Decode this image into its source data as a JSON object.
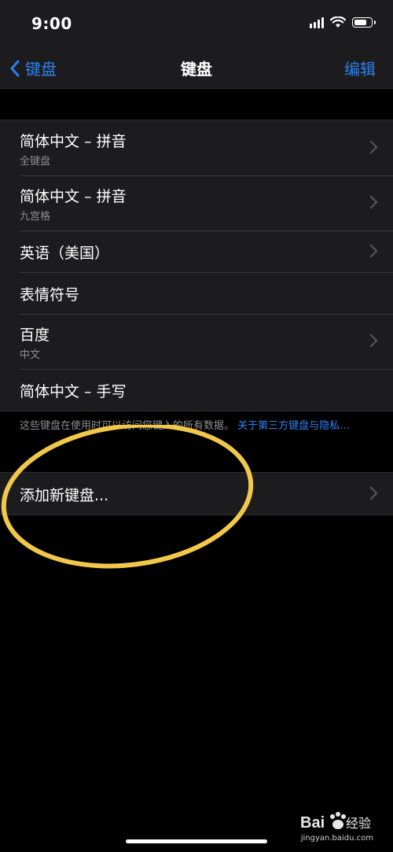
{
  "status_bar": {
    "time": "9:00",
    "icons": [
      "cellular-signal-icon",
      "wifi-icon",
      "battery-icon"
    ]
  },
  "nav": {
    "back_label": "键盘",
    "title": "键盘",
    "edit_label": "编辑"
  },
  "keyboards": [
    {
      "title": "简体中文 – 拼音",
      "subtitle": "全键盘",
      "chevron": true
    },
    {
      "title": "简体中文 – 拼音",
      "subtitle": "九宫格",
      "chevron": true
    },
    {
      "title": "英语（美国）",
      "subtitle": "",
      "chevron": true
    },
    {
      "title": "表情符号",
      "subtitle": "",
      "chevron": false
    },
    {
      "title": "百度",
      "subtitle": "中文",
      "chevron": true
    },
    {
      "title": "简体中文 – 手写",
      "subtitle": "",
      "chevron": false
    }
  ],
  "footnote": {
    "text": "这些键盘在使用时可以访问您键入的所有数据。",
    "link": "关于第三方键盘与隐私…"
  },
  "add_keyboard": {
    "label": "添加新键盘..."
  },
  "annotation": {
    "shape": "ellipse",
    "color": "#f2c84b"
  },
  "watermark": {
    "url": "jingyan.baidu.com"
  },
  "colors": {
    "accent": "#2f80ed",
    "background": "#000000",
    "cell": "#1c1c1e",
    "secondary_text": "#8e8e93"
  }
}
